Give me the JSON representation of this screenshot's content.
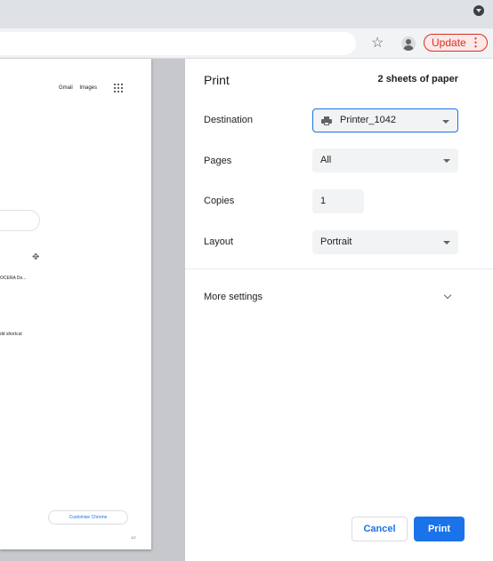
{
  "browser": {
    "update_label": "Update",
    "menu_glyph": "⋮",
    "bookmark_glyph": "☆"
  },
  "preview": {
    "links": [
      "Gmail",
      "Images"
    ],
    "shortcut_label": "OCERA Do...",
    "add_shortcut_label": "dd shortcut",
    "customise_label": "Customise Chrome",
    "page_number": "1/2"
  },
  "print": {
    "title": "Print",
    "sheets": "2 sheets of paper",
    "destination_label": "Destination",
    "destination_value": "Printer_1042",
    "pages_label": "Pages",
    "pages_value": "All",
    "copies_label": "Copies",
    "copies_value": "1",
    "layout_label": "Layout",
    "layout_value": "Portrait",
    "more_settings": "More settings",
    "cancel": "Cancel",
    "print_button": "Print"
  },
  "colors": {
    "accent": "#1a73e8",
    "update_red": "#d93025"
  }
}
